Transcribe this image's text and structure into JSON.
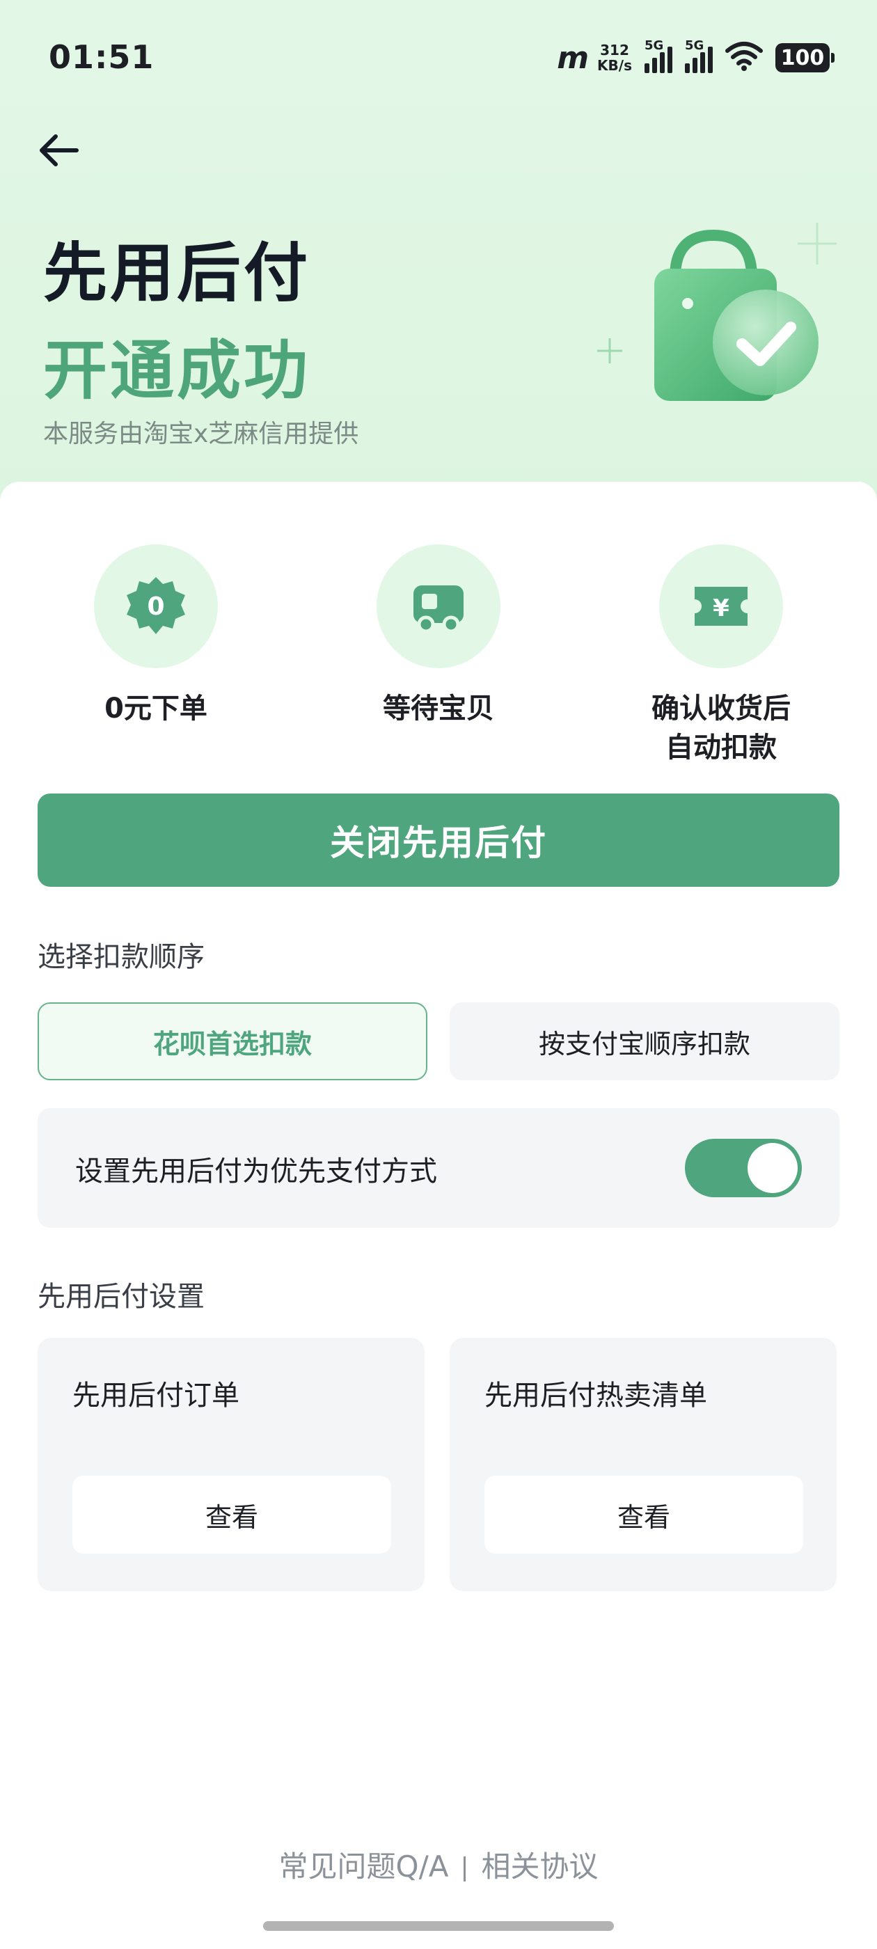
{
  "status_bar": {
    "time": "01:51",
    "carrier_logo": "ⅿ",
    "speed_value": "312",
    "speed_unit": "KB/s",
    "network_1": "5G",
    "network_2": "5G",
    "battery": "100"
  },
  "header": {
    "title_line1": "先用后付",
    "title_line2": "开通成功",
    "subtitle": "本服务由淘宝x芝麻信用提供",
    "illustration_icon": "shopping-bag-check-icon"
  },
  "features": [
    {
      "icon": "zero-badge-icon",
      "icon_text": "0",
      "label": "0元下单"
    },
    {
      "icon": "truck-icon",
      "label": "等待宝贝"
    },
    {
      "icon": "yuan-ticket-icon",
      "icon_text": "¥",
      "label_line1": "确认收货后",
      "label_line2": "自动扣款"
    }
  ],
  "close_button_label": "关闭先用后付",
  "deduction": {
    "label": "选择扣款顺序",
    "options": [
      "花呗首选扣款",
      "按支付宝顺序扣款"
    ],
    "selected": "花呗首选扣款"
  },
  "priority_toggle": {
    "label": "设置先用后付为优先支付方式",
    "enabled": true
  },
  "settings": {
    "label": "先用后付设置",
    "cards": [
      {
        "title": "先用后付订单",
        "button": "查看"
      },
      {
        "title": "先用后付热卖清单",
        "button": "查看"
      }
    ]
  },
  "footer": {
    "faq": "常见问题Q/A",
    "agreement": "相关协议"
  },
  "colors": {
    "accent": "#4ea57e",
    "hero_bg": "#e0f6e4",
    "title_dark": "#141a26"
  }
}
